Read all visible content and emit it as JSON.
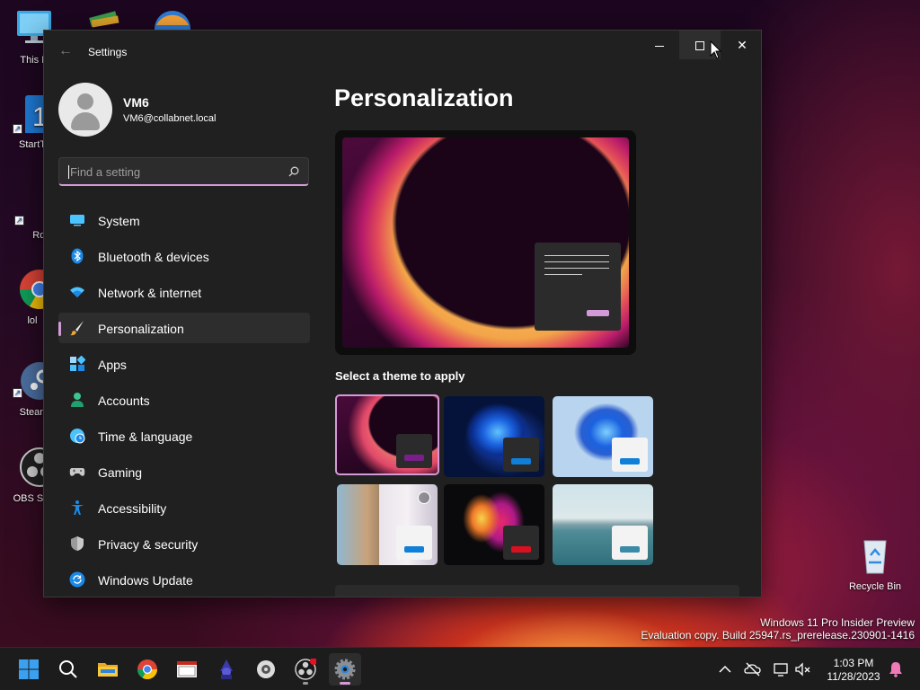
{
  "desktop": {
    "icons": [
      {
        "label": "This P",
        "glyph": "monitor-icon"
      },
      {
        "label": "StartT",
        "glyph": "start-icon"
      },
      {
        "label": "RqS",
        "glyph": "app-icon"
      },
      {
        "label": "lol",
        "glyph": "chrome-icon"
      },
      {
        "label": "Stean",
        "glyph": "steam-icon"
      },
      {
        "label": "OBS Stu",
        "glyph": "obs-icon"
      }
    ],
    "recycle_bin": "Recycle Bin",
    "watermark": {
      "line1": "Windows 11 Pro Insider Preview",
      "line2": "Evaluation copy. Build 25947.rs_prerelease.230901-1416"
    }
  },
  "window": {
    "title": "Settings",
    "accent": "#d49ad8"
  },
  "profile": {
    "name": "VM6",
    "email": "VM6@collabnet.local"
  },
  "search": {
    "placeholder": "Find a setting"
  },
  "nav": {
    "items": [
      {
        "label": "System",
        "icon": "monitor-icon"
      },
      {
        "label": "Bluetooth & devices",
        "icon": "bluetooth-icon"
      },
      {
        "label": "Network & internet",
        "icon": "wifi-icon"
      },
      {
        "label": "Personalization",
        "icon": "brush-icon",
        "active": true
      },
      {
        "label": "Apps",
        "icon": "apps-icon"
      },
      {
        "label": "Accounts",
        "icon": "person-icon"
      },
      {
        "label": "Time & language",
        "icon": "globe-clock-icon"
      },
      {
        "label": "Gaming",
        "icon": "gamepad-icon"
      },
      {
        "label": "Accessibility",
        "icon": "accessibility-icon"
      },
      {
        "label": "Privacy & security",
        "icon": "shield-icon"
      },
      {
        "label": "Windows Update",
        "icon": "update-icon"
      }
    ]
  },
  "main": {
    "title": "Personalization",
    "themes_heading": "Select a theme to apply",
    "themes": [
      {
        "name": "glow-dark",
        "selected": true,
        "accent": "#7a1f8a"
      },
      {
        "name": "bloom-dark",
        "selected": false,
        "accent": "#0f7fd8"
      },
      {
        "name": "bloom-light",
        "selected": false,
        "accent": "#0f7fd8"
      },
      {
        "name": "spotlight",
        "selected": false,
        "accent": "#0f7fd8"
      },
      {
        "name": "flow",
        "selected": false,
        "accent": "#d81020"
      },
      {
        "name": "lake",
        "selected": false,
        "accent": "#3a8aa8"
      }
    ]
  },
  "taskbar": {
    "apps": [
      "start-icon",
      "search-icon",
      "file-explorer-icon",
      "chrome-icon",
      "terminal-icon",
      "wizard-icon",
      "gpu-tool-icon",
      "obs-icon",
      "settings-icon"
    ],
    "clock_time": "1:03 PM",
    "clock_date": "11/28/2023"
  }
}
